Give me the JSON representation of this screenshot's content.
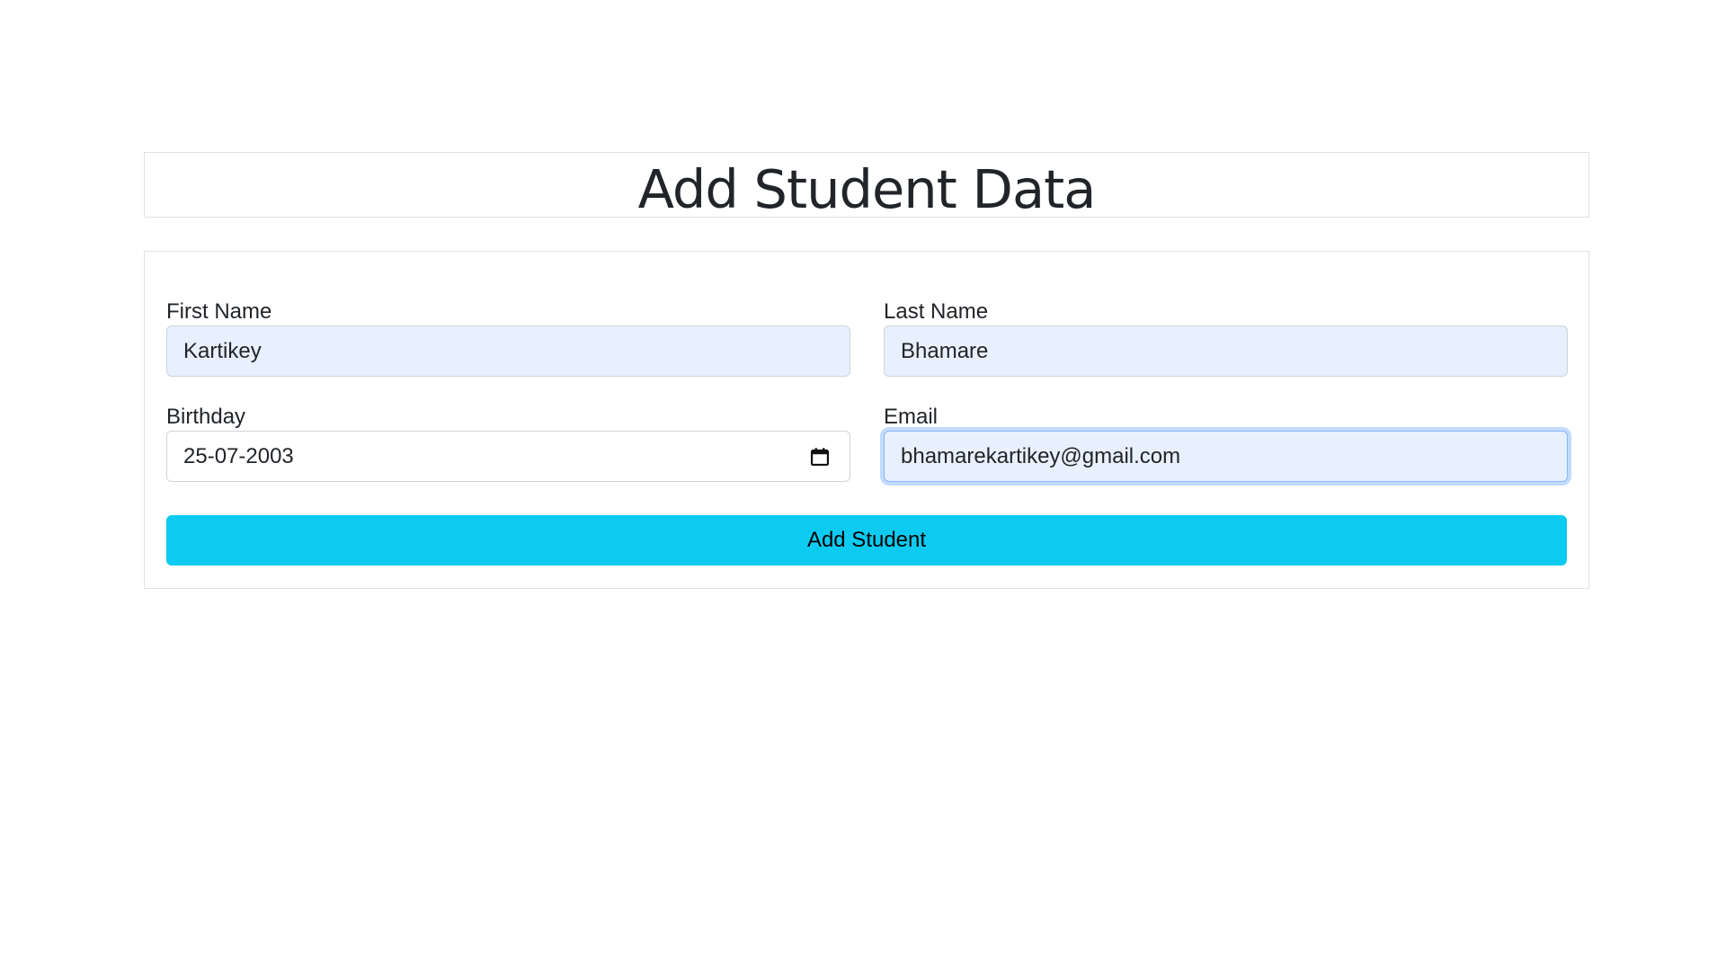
{
  "page": {
    "title": "Add Student Data"
  },
  "form": {
    "first_name": {
      "label": "First Name",
      "value": "Kartikey"
    },
    "last_name": {
      "label": "Last Name",
      "value": "Bhamare"
    },
    "birthday": {
      "label": "Birthday",
      "value": "25-07-2003",
      "icon": "calendar-icon"
    },
    "email": {
      "label": "Email",
      "value": "bhamarekartikey@gmail.com",
      "focused": true
    },
    "submit_label": "Add Student"
  },
  "colors": {
    "button_bg": "#0dcaf0",
    "autofill_bg": "#e8f0fe",
    "focus_border": "#86b7fe",
    "border": "#dee2e6",
    "text": "#212529"
  }
}
